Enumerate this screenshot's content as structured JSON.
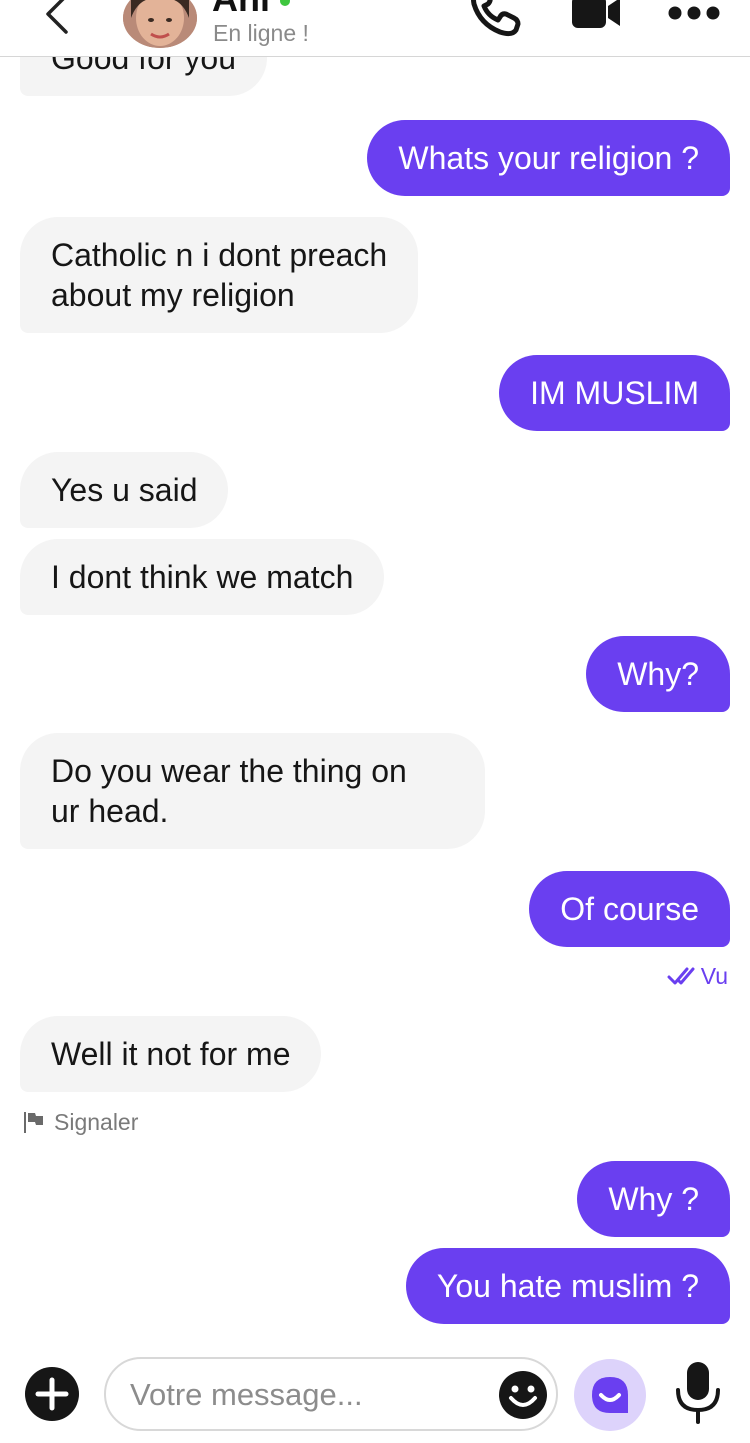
{
  "header": {
    "contact_name": "Ani",
    "status": "En ligne !",
    "online_color": "#3ec63e",
    "icons": [
      "chevron-left-icon",
      "phone-icon",
      "video-icon",
      "more-icon"
    ]
  },
  "messages": [
    {
      "direction": "in",
      "lines": [
        "Good for you"
      ]
    },
    {
      "direction": "out",
      "lines": [
        "Whats your religion ?"
      ]
    },
    {
      "direction": "in",
      "lines": [
        "Catholic n i dont preach",
        "about my religion"
      ]
    },
    {
      "direction": "out",
      "lines": [
        "IM MUSLIM"
      ]
    },
    {
      "direction": "in",
      "lines": [
        "Yes u said"
      ]
    },
    {
      "direction": "in",
      "lines": [
        "I dont think we match"
      ]
    },
    {
      "direction": "out",
      "lines": [
        "Why?"
      ]
    },
    {
      "direction": "in",
      "lines": [
        "Do you wear the thing on",
        "ur head."
      ]
    },
    {
      "direction": "out",
      "lines": [
        "Of course"
      ]
    },
    {
      "direction": "in",
      "lines": [
        "Well it not for me"
      ]
    },
    {
      "direction": "out",
      "lines": [
        "Why ?"
      ]
    },
    {
      "direction": "out",
      "lines": [
        "You hate muslim ?"
      ]
    }
  ],
  "seen_label": "Vu",
  "report_label": "Signaler",
  "composer": {
    "placeholder": "Votre message...",
    "icons": [
      "plus-icon",
      "emoji-icon",
      "sticker-icon",
      "microphone-icon"
    ]
  },
  "colors": {
    "accent": "#6a3ff0",
    "incoming_bubble": "#f4f4f4",
    "sticker_bg": "#ddd3fb"
  }
}
